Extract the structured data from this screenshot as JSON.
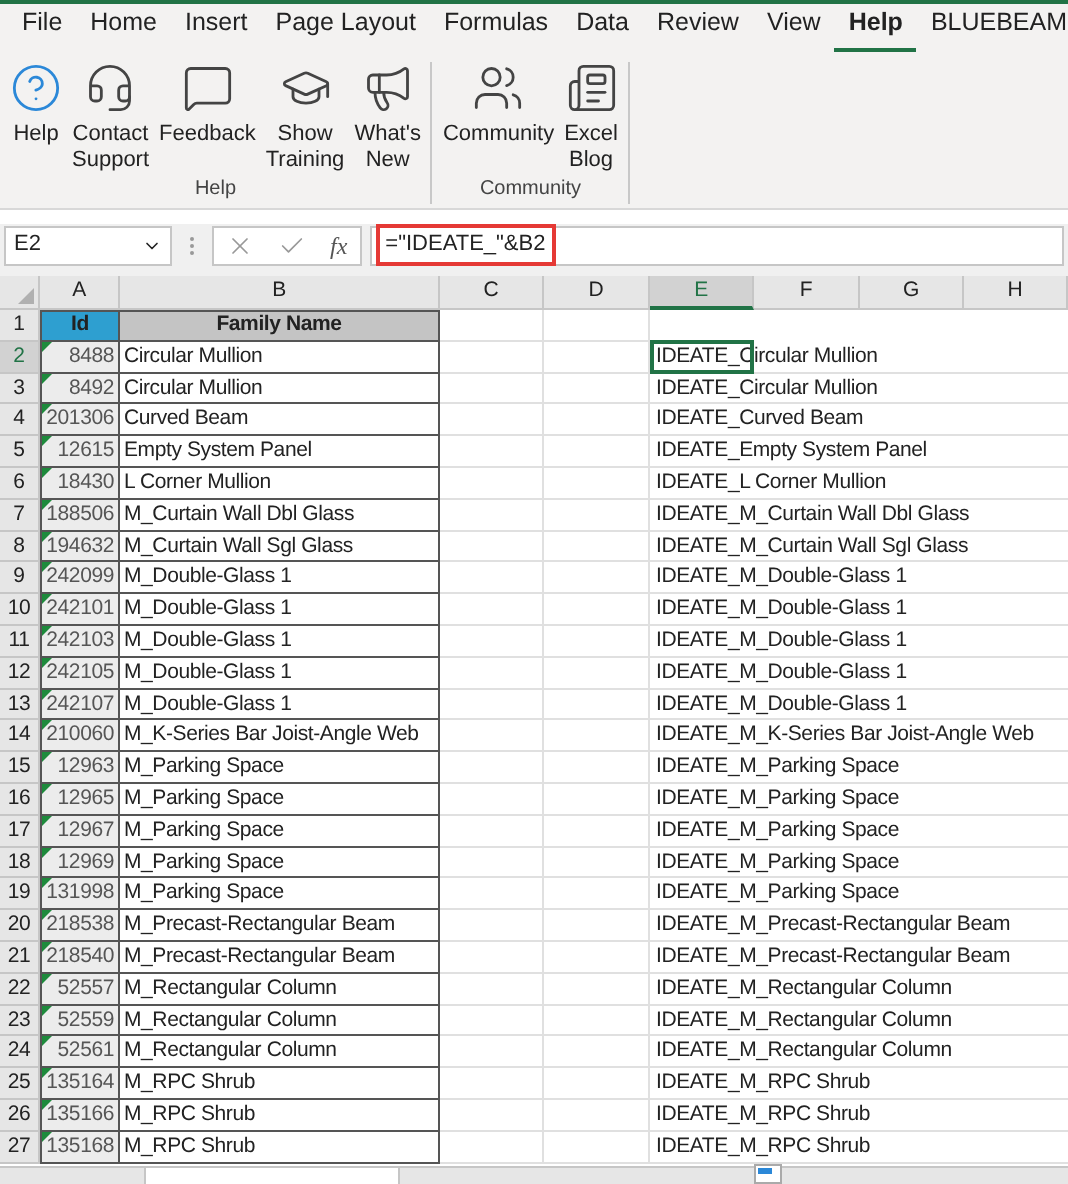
{
  "menu_tabs": [
    {
      "label": "File",
      "selected": false
    },
    {
      "label": "Home",
      "selected": false
    },
    {
      "label": "Insert",
      "selected": false
    },
    {
      "label": "Page Layout",
      "selected": false
    },
    {
      "label": "Formulas",
      "selected": false
    },
    {
      "label": "Data",
      "selected": false
    },
    {
      "label": "Review",
      "selected": false
    },
    {
      "label": "View",
      "selected": false
    },
    {
      "label": "Help",
      "selected": true
    },
    {
      "label": "BLUEBEAM",
      "selected": false
    }
  ],
  "ribbon_groups": [
    {
      "label": "Help",
      "buttons": [
        {
          "kind": "help",
          "lines": [
            "Help"
          ]
        },
        {
          "kind": "support",
          "lines": [
            "Contact",
            "Support"
          ]
        },
        {
          "kind": "feedback",
          "lines": [
            "Feedback"
          ]
        },
        {
          "kind": "training",
          "lines": [
            "Show",
            "Training"
          ]
        },
        {
          "kind": "news",
          "lines": [
            "What's",
            "New"
          ]
        }
      ]
    },
    {
      "label": "Community",
      "buttons": [
        {
          "kind": "community",
          "lines": [
            "Community"
          ]
        },
        {
          "kind": "blog",
          "lines": [
            "Excel",
            "Blog"
          ]
        }
      ]
    }
  ],
  "formula_bar": {
    "name_box": "E2",
    "function_label": "fx",
    "formula": "=\"IDEATE_\"&B2",
    "highlighted": true
  },
  "columns": [
    {
      "label": "A",
      "selected": false
    },
    {
      "label": "B",
      "selected": false
    },
    {
      "label": "C",
      "selected": false
    },
    {
      "label": "D",
      "selected": false
    },
    {
      "label": "E",
      "selected": true
    },
    {
      "label": "F",
      "selected": false
    },
    {
      "label": "G",
      "selected": false
    },
    {
      "label": "H",
      "selected": false
    }
  ],
  "header_row": {
    "number": "1",
    "id": "Id",
    "name": "Family Name"
  },
  "rows": [
    {
      "number": "2",
      "id": "8488",
      "name": "Circular Mullion",
      "result": "IDEATE_Circular Mullion",
      "selected": true
    },
    {
      "number": "3",
      "id": "8492",
      "name": "Circular Mullion",
      "result": "IDEATE_Circular Mullion",
      "selected": false
    },
    {
      "number": "4",
      "id": "201306",
      "name": "Curved Beam",
      "result": "IDEATE_Curved Beam",
      "selected": false
    },
    {
      "number": "5",
      "id": "12615",
      "name": "Empty System Panel",
      "result": "IDEATE_Empty System Panel",
      "selected": false
    },
    {
      "number": "6",
      "id": "18430",
      "name": "L Corner Mullion",
      "result": "IDEATE_L Corner Mullion",
      "selected": false
    },
    {
      "number": "7",
      "id": "188506",
      "name": "M_Curtain Wall Dbl Glass",
      "result": "IDEATE_M_Curtain Wall Dbl Glass",
      "selected": false
    },
    {
      "number": "8",
      "id": "194632",
      "name": "M_Curtain Wall Sgl Glass",
      "result": "IDEATE_M_Curtain Wall Sgl Glass",
      "selected": false
    },
    {
      "number": "9",
      "id": "242099",
      "name": "M_Double-Glass 1",
      "result": "IDEATE_M_Double-Glass 1",
      "selected": false
    },
    {
      "number": "10",
      "id": "242101",
      "name": "M_Double-Glass 1",
      "result": "IDEATE_M_Double-Glass 1",
      "selected": false
    },
    {
      "number": "11",
      "id": "242103",
      "name": "M_Double-Glass 1",
      "result": "IDEATE_M_Double-Glass 1",
      "selected": false
    },
    {
      "number": "12",
      "id": "242105",
      "name": "M_Double-Glass 1",
      "result": "IDEATE_M_Double-Glass 1",
      "selected": false
    },
    {
      "number": "13",
      "id": "242107",
      "name": "M_Double-Glass 1",
      "result": "IDEATE_M_Double-Glass 1",
      "selected": false
    },
    {
      "number": "14",
      "id": "210060",
      "name": "M_K-Series Bar Joist-Angle Web",
      "result": "IDEATE_M_K-Series Bar Joist-Angle Web",
      "selected": false
    },
    {
      "number": "15",
      "id": "12963",
      "name": "M_Parking Space",
      "result": "IDEATE_M_Parking Space",
      "selected": false
    },
    {
      "number": "16",
      "id": "12965",
      "name": "M_Parking Space",
      "result": "IDEATE_M_Parking Space",
      "selected": false
    },
    {
      "number": "17",
      "id": "12967",
      "name": "M_Parking Space",
      "result": "IDEATE_M_Parking Space",
      "selected": false
    },
    {
      "number": "18",
      "id": "12969",
      "name": "M_Parking Space",
      "result": "IDEATE_M_Parking Space",
      "selected": false
    },
    {
      "number": "19",
      "id": "131998",
      "name": "M_Parking Space",
      "result": "IDEATE_M_Parking Space",
      "selected": false
    },
    {
      "number": "20",
      "id": "218538",
      "name": "M_Precast-Rectangular Beam",
      "result": "IDEATE_M_Precast-Rectangular Beam",
      "selected": false
    },
    {
      "number": "21",
      "id": "218540",
      "name": "M_Precast-Rectangular Beam",
      "result": "IDEATE_M_Precast-Rectangular Beam",
      "selected": false
    },
    {
      "number": "22",
      "id": "52557",
      "name": "M_Rectangular Column",
      "result": "IDEATE_M_Rectangular Column",
      "selected": false
    },
    {
      "number": "23",
      "id": "52559",
      "name": "M_Rectangular Column",
      "result": "IDEATE_M_Rectangular Column",
      "selected": false
    },
    {
      "number": "24",
      "id": "52561",
      "name": "M_Rectangular Column",
      "result": "IDEATE_M_Rectangular Column",
      "selected": false
    },
    {
      "number": "25",
      "id": "135164",
      "name": "M_RPC Shrub",
      "result": "IDEATE_M_RPC Shrub",
      "selected": false
    },
    {
      "number": "26",
      "id": "135166",
      "name": "M_RPC Shrub",
      "result": "IDEATE_M_RPC Shrub",
      "selected": false
    },
    {
      "number": "27",
      "id": "135168",
      "name": "M_RPC Shrub",
      "result": "IDEATE_M_RPC Shrub",
      "selected": false
    }
  ]
}
